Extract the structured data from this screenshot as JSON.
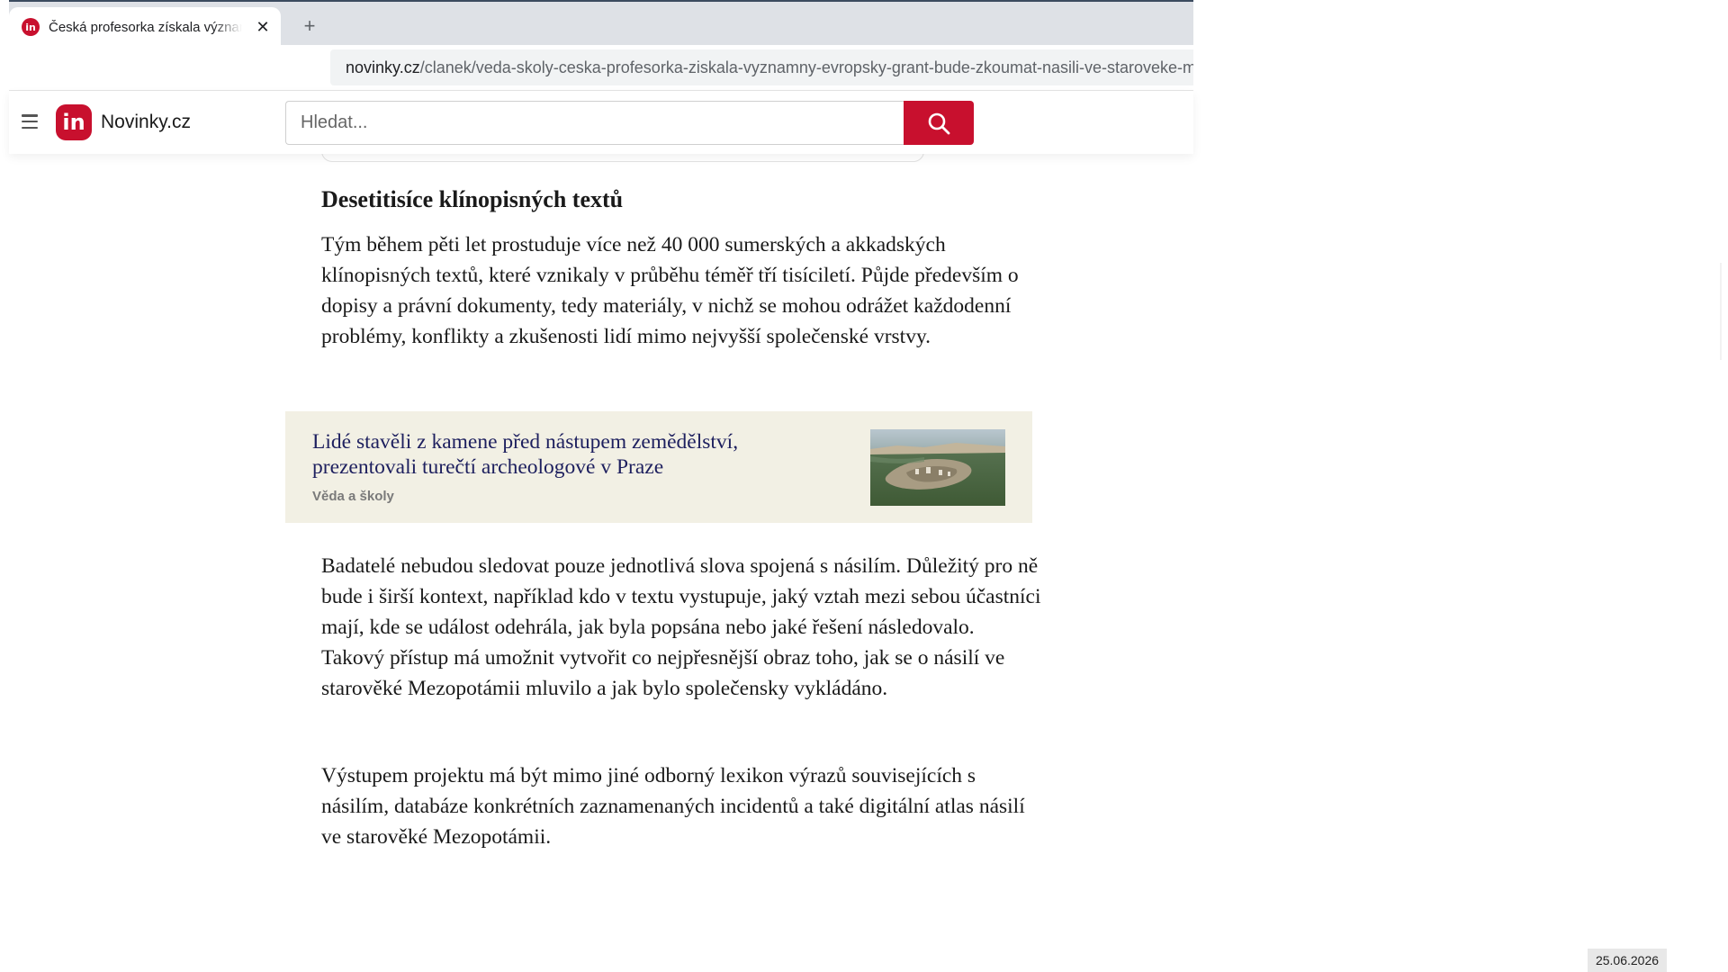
{
  "browser": {
    "tab": {
      "favicon_text": "in",
      "title": "Česká profesorka získala významný evropský grant",
      "close_glyph": "✕"
    },
    "new_tab_glyph": "+",
    "address": {
      "host": "novinky.cz",
      "path": "/clanek/veda-skoly-ceska-profesorka-ziskala-vyznamny-evropsky-grant-bude-zkoumat-nasili-ve-staroveke-mez..."
    }
  },
  "site": {
    "logo_mark": "in",
    "logo_text": "Novinky.cz",
    "search_placeholder": "Hledat...",
    "brand_color": "#c8102e",
    "icons": {
      "menu": "hamburger-menu-icon",
      "search": "magnifier-icon"
    }
  },
  "article": {
    "heading": "Desetitisíce klínopisných textů",
    "paragraph_1": "Tým během pěti let prostuduje více než 40 000 sumerských a akkadských klínopisných textů, které vznikaly v průběhu téměř tří tisíciletí. Půjde především o dopisy a právní dokumenty, tedy materiály, v nichž se mohou odrážet každodenní problémy, konflikty a zkušenosti lidí mimo nejvyšší společenské vrstvy.",
    "related": {
      "title": "Lidé stavěli z kamene před nástupem zemědělství, prezentovali turečtí archeologové v Praze",
      "category": "Věda a školy",
      "background_color": "#f2f0e4",
      "title_color": "#1d1f5e"
    },
    "paragraph_2": "Badatelé nebudou sledovat pouze jednotlivá slova spojená s násilím. Důležitý pro ně bude i širší kontext, například kdo v textu vystupuje, jaký vztah mezi sebou účastníci mají, kde se událost odehrála, jak byla popsána nebo jaké řešení následovalo. Takový přístup má umožnit vytvořit co nejpřesnější obraz toho, jak se o násilí ve starověké Mezopotámii mluvilo a jak bylo společensky vykládáno.",
    "paragraph_3": "Výstupem projektu má být mimo jiné odborný lexikon výrazů souvisejících s násilím, databáze konkrétních zaznamenaných incidentů a také digitální atlas násilí ve starověké Mezopotámii."
  },
  "system": {
    "date": "25.06.2026"
  }
}
